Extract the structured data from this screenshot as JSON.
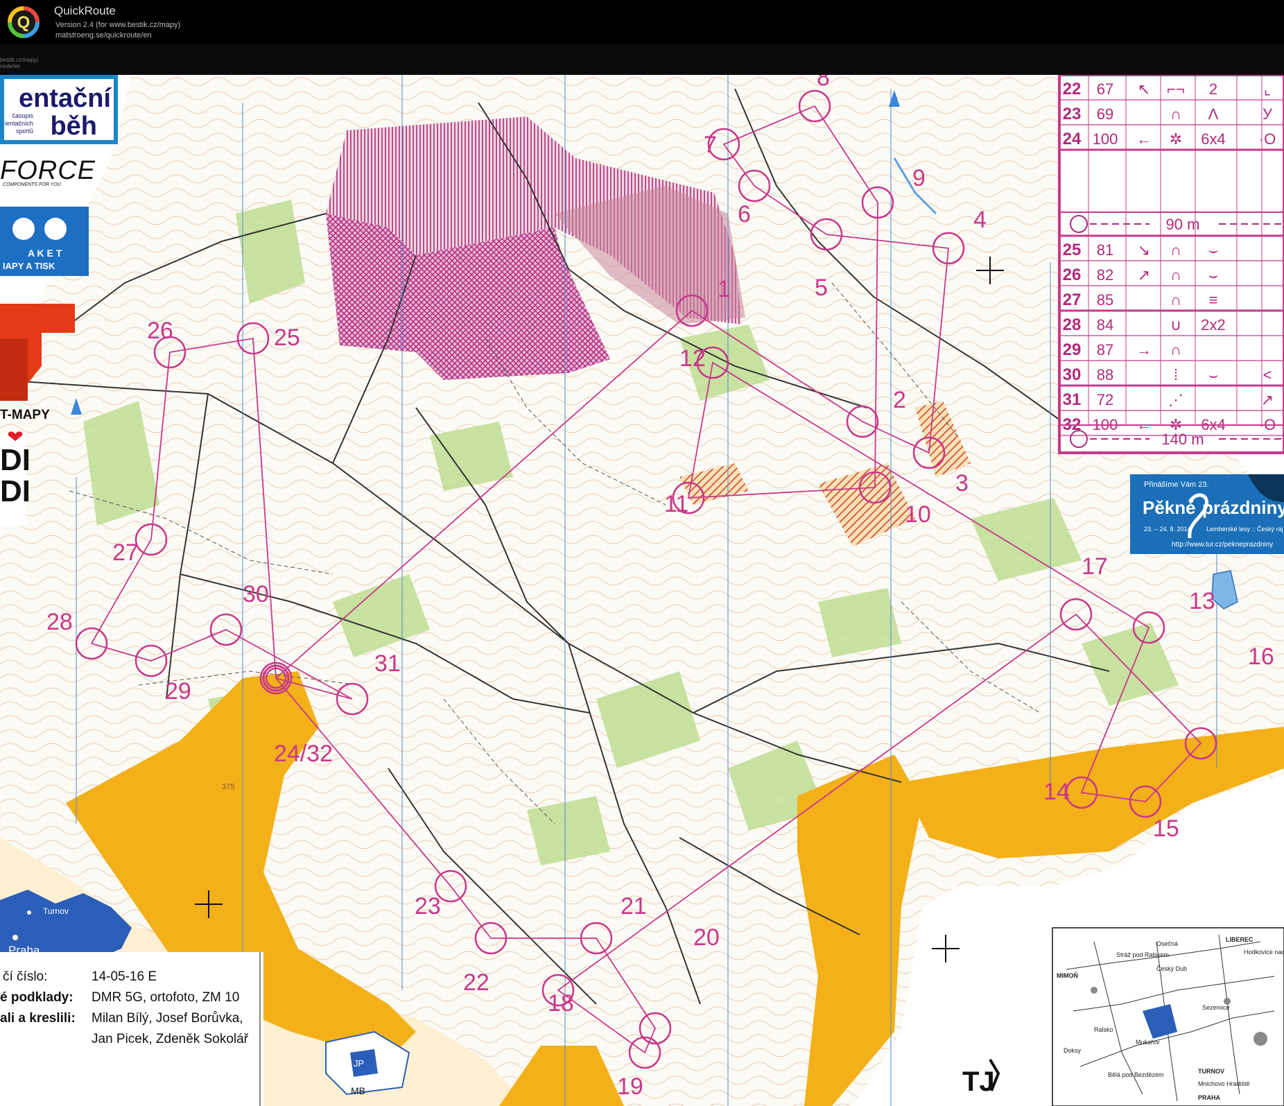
{
  "app": {
    "title": "QuickRoute",
    "version": "Version 2.4  (for www.bestik.cz/mapy)",
    "url": "matstroeng.se/quickroute/en",
    "separator_text": "bestik.cz/mapy)\nroute/en",
    "logo_letter": "Q"
  },
  "sponsors": {
    "magazine_title_line1": "entační",
    "magazine_title_line2": "běh",
    "magazine_sub1": "časopis",
    "magazine_sub2": "ientačních",
    "magazine_sub3": "sportů",
    "force_logo": "FORCE",
    "force_sub": "COMPONENTS FOR YOU",
    "raket_line1": "A K E T",
    "raket_line2": "IAPY A TISK",
    "tmapy": "T-MAPY",
    "didi_line1": "DI",
    "didi_line2": "DI",
    "tj_logo": "TJ"
  },
  "controls": [
    {
      "label": "1"
    },
    {
      "label": "2"
    },
    {
      "label": "3"
    },
    {
      "label": "4"
    },
    {
      "label": "5"
    },
    {
      "label": "6"
    },
    {
      "label": "7"
    },
    {
      "label": "8"
    },
    {
      "label": "9"
    },
    {
      "label": "10"
    },
    {
      "label": "11"
    },
    {
      "label": "12"
    },
    {
      "label": "13"
    },
    {
      "label": "14"
    },
    {
      "label": "15"
    },
    {
      "label": "16"
    },
    {
      "label": "17"
    },
    {
      "label": "18"
    },
    {
      "label": "19"
    },
    {
      "label": "20"
    },
    {
      "label": "21"
    },
    {
      "label": "22"
    },
    {
      "label": "23"
    },
    {
      "label": "24/32"
    },
    {
      "label": "25"
    },
    {
      "label": "26"
    },
    {
      "label": "27"
    },
    {
      "label": "28"
    },
    {
      "label": "29"
    },
    {
      "label": "30"
    },
    {
      "label": "31"
    }
  ],
  "description_table": {
    "rows": [
      {
        "num": "22",
        "code": "67",
        "sym": "↖",
        "feat": "⌐¬",
        "extra": "2",
        "last": "⌞"
      },
      {
        "num": "23",
        "code": "69",
        "sym": "",
        "feat": "∩",
        "extra": "Λ",
        "last": "У"
      },
      {
        "num": "24",
        "code": "100",
        "sym": "←",
        "feat": "✲",
        "extra": "6x4",
        "last": "·O"
      },
      {
        "num": "25",
        "code": "81",
        "sym": "↘",
        "feat": "∩",
        "extra": "⌣",
        "last": ""
      },
      {
        "num": "26",
        "code": "82",
        "sym": "↗",
        "feat": "∩",
        "extra": "⌣",
        "last": ""
      },
      {
        "num": "27",
        "code": "85",
        "sym": "",
        "feat": "∩",
        "extra": "≡",
        "last": ""
      },
      {
        "num": "28",
        "code": "84",
        "sym": "",
        "feat": "∪",
        "extra": "2x2",
        "last": ""
      },
      {
        "num": "29",
        "code": "87",
        "sym": "→",
        "feat": "∩",
        "extra": "",
        "last": ""
      },
      {
        "num": "30",
        "code": "88",
        "sym": "",
        "feat": "⁞",
        "extra": "⌣",
        "last": "<"
      },
      {
        "num": "31",
        "code": "72",
        "sym": "",
        "feat": "⋰",
        "extra": "",
        "last": "↗"
      },
      {
        "num": "32",
        "code": "100",
        "sym": "←",
        "feat": "✲",
        "extra": "6x4",
        "last": "·O"
      }
    ],
    "leg1": "90 m",
    "leg2": "140 m"
  },
  "banner": {
    "line1": "Přinášíme Vám 23.",
    "title1": "Pěkné",
    "title2": "prázdniny",
    "dates": "23. – 24. 8. 2014",
    "place": "Lemberské lesy :: Český ráj",
    "url": "http://www.tur.cz/pekneprazdniny"
  },
  "map_info": {
    "row1_label": "čí číslo:",
    "row1_value": "14-05-16 E",
    "row2_label": "é podklady:",
    "row2_value": "DMR 5G, ortofoto, ZM 10",
    "row3_label": "ali a kreslili:",
    "row3_value": "Milan Bílý, Josef Borůvka,",
    "row4_value": "Jan Picek, Zdeněk Sokolář"
  },
  "country_map": {
    "city1": "Turnov",
    "city2": "Praha"
  },
  "area_map": {
    "label1": "JP",
    "label2": "MB"
  },
  "inset": {
    "places": [
      "LIBEREC",
      "Osečná",
      "Stráž pod Ralskem",
      "Český Dub",
      "Hodkovice nad Mohelkou",
      "MIMOŇ",
      "Sezemice",
      "Ralsko",
      "Mukařov",
      "Doksy",
      "Bělá pod Bezdězem",
      "TURNOV",
      "Mnichovo Hradiště",
      "PRAHA"
    ]
  },
  "elevation": "375",
  "colors": {
    "course": "#c8388a",
    "open_land": "#f3b019",
    "forbidden": "#b02a7a",
    "vegetation": "#b9d98a",
    "contours": "#c07a50"
  }
}
